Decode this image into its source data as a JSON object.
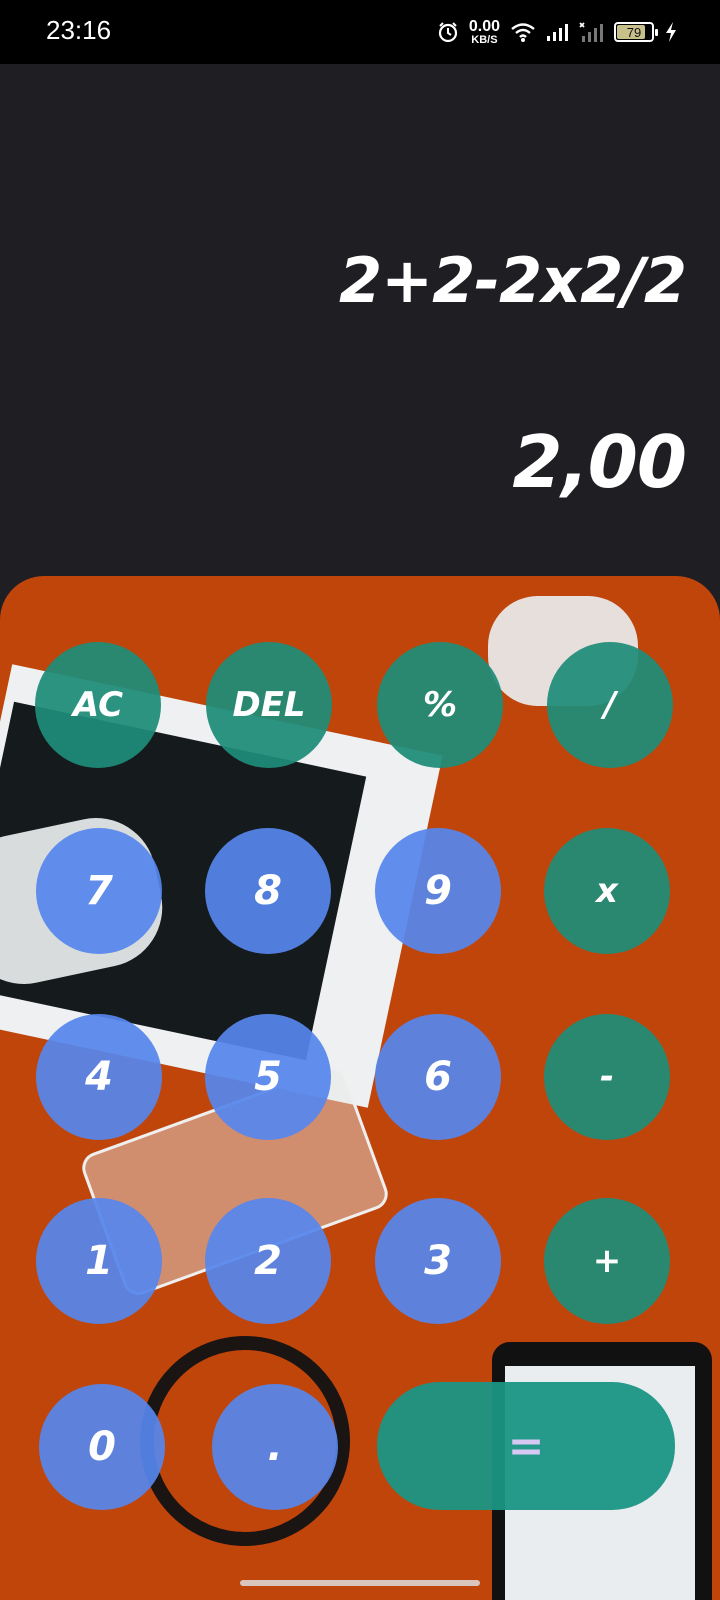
{
  "status_bar": {
    "time": "23:16",
    "net_speed_value": "0.00",
    "net_speed_unit": "KB/S",
    "battery_level": "79",
    "icons": [
      "alarm-icon",
      "wifi-icon",
      "signal-icon",
      "signal-off-icon",
      "battery-icon",
      "charging-icon"
    ]
  },
  "display": {
    "expression": "2+2-2x2/2",
    "result": "2,00"
  },
  "keypad": {
    "keys": {
      "ac": "AC",
      "del": "DEL",
      "percent": "%",
      "divide": "/",
      "seven": "7",
      "eight": "8",
      "nine": "9",
      "multiply": "x",
      "four": "4",
      "five": "5",
      "six": "6",
      "minus": "-",
      "one": "1",
      "two": "2",
      "three": "3",
      "plus": "+",
      "zero": "0",
      "dot": ".",
      "equals": "="
    }
  },
  "colors": {
    "number_key": "#5686EC",
    "operator_key": "#1E8C78",
    "equals_key": "#1A9684",
    "keypad_background": "#C0450B",
    "display_background": "#1F1E23"
  }
}
